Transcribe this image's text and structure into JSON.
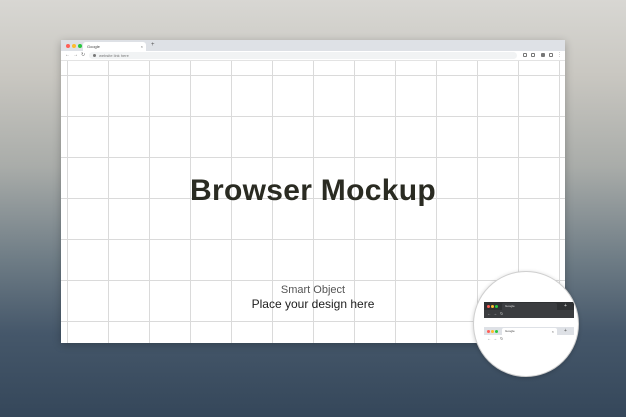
{
  "browser": {
    "tab_title": "Google",
    "tab_close": "×",
    "new_tab": "+",
    "back": "←",
    "forward": "→",
    "reload": "↻",
    "address": "website link here"
  },
  "content": {
    "headline": "Browser Mockup",
    "subline1": "Smart Object",
    "subline2": "Place your design here"
  },
  "inset": {
    "dark_tab_title": "Google",
    "light_tab_title": "Google",
    "close": "×",
    "plus": "+",
    "back": "←",
    "forward": "→",
    "reload": "↻"
  },
  "colors": {
    "traffic_red": "#ff5f57",
    "traffic_yellow": "#febc2e",
    "traffic_green": "#28c840",
    "headline": "#2a2b22",
    "dark_theme": "#2f3133",
    "light_theme": "#dee1e6"
  }
}
